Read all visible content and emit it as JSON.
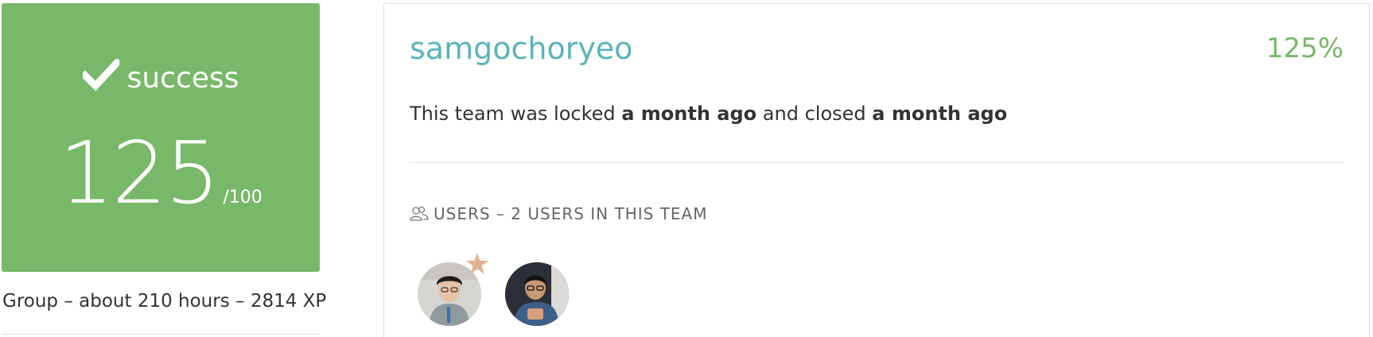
{
  "score": {
    "status": "success",
    "value": "125",
    "max": "/100",
    "icon": "check-icon",
    "color": "#78b869"
  },
  "group_meta": "Group – about 210 hours – 2814 XP",
  "team": {
    "name": "samgochoryeo",
    "percent": "125%",
    "status_prefix": "This team was locked ",
    "locked_time": "a month ago",
    "status_middle": " and closed ",
    "closed_time": "a month ago",
    "name_color": "#5ab4b9"
  },
  "users": {
    "header": "USERS – 2 USERS IN THIS TEAM",
    "icon": "users-icon",
    "avatars": [
      {
        "leader": true,
        "icon": "star-icon"
      },
      {
        "leader": false
      }
    ]
  }
}
